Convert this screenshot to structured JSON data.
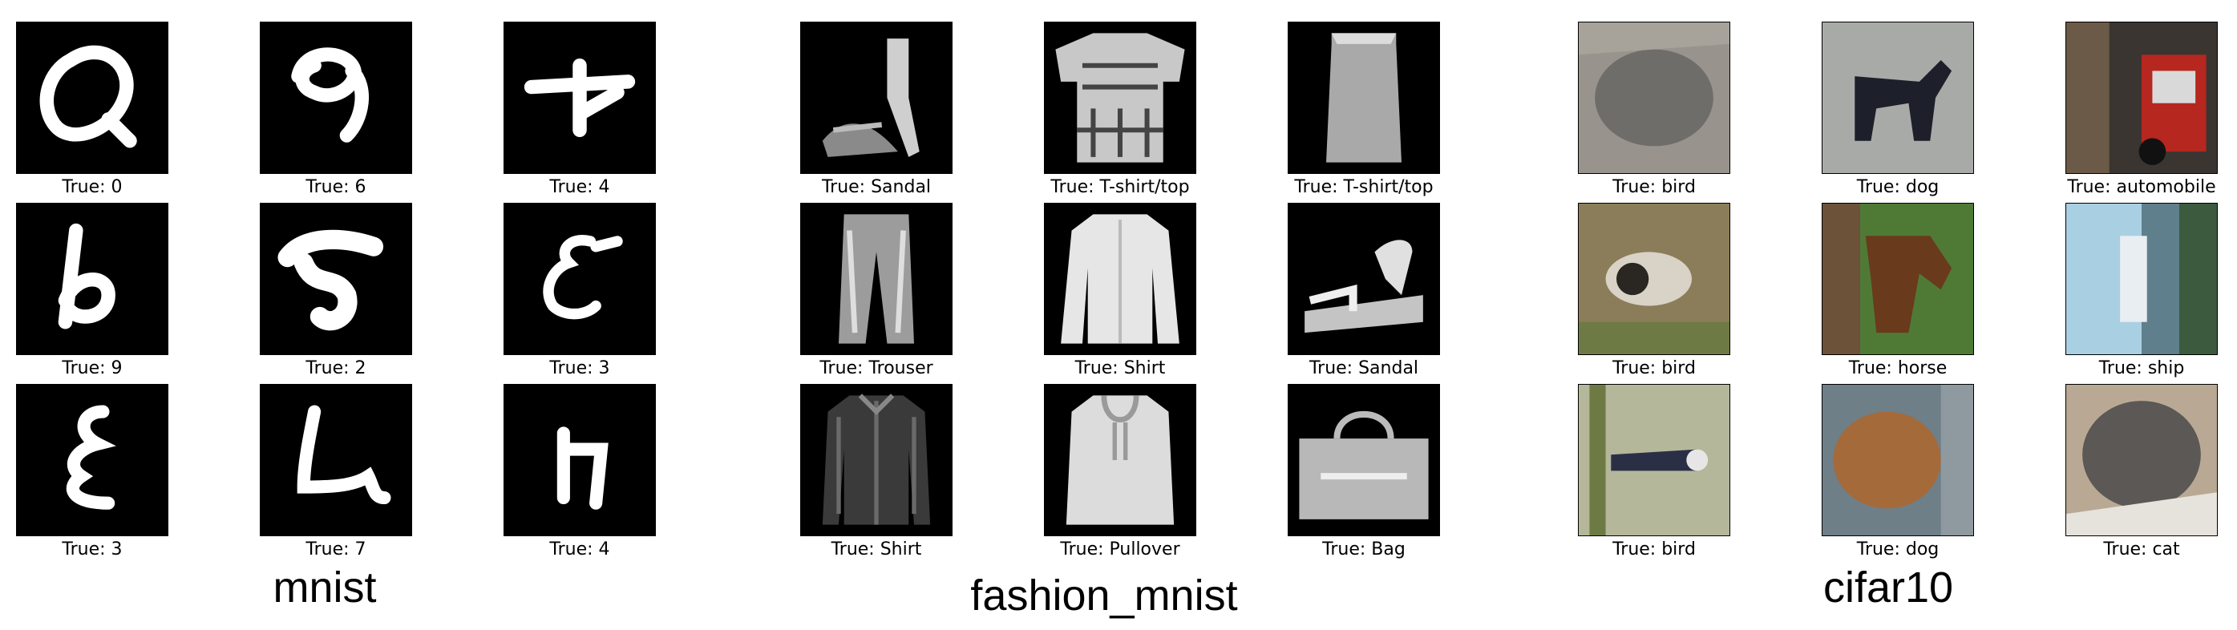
{
  "groups": [
    {
      "title": "mnist",
      "cells": [
        {
          "label": "True: 0",
          "icon": "digit-icon"
        },
        {
          "label": "True: 6",
          "icon": "digit-icon"
        },
        {
          "label": "True: 4",
          "icon": "digit-icon"
        },
        {
          "label": "True: 9",
          "icon": "digit-icon"
        },
        {
          "label": "True: 2",
          "icon": "digit-icon"
        },
        {
          "label": "True: 3",
          "icon": "digit-icon"
        },
        {
          "label": "True: 3",
          "icon": "digit-icon"
        },
        {
          "label": "True: 7",
          "icon": "digit-icon"
        },
        {
          "label": "True: 4",
          "icon": "digit-icon"
        }
      ]
    },
    {
      "title": "fashion_mnist",
      "cells": [
        {
          "label": "True: Sandal",
          "icon": "sandal-icon"
        },
        {
          "label": "True: T-shirt/top",
          "icon": "tshirt-icon"
        },
        {
          "label": "True: T-shirt/top",
          "icon": "tshirt-icon"
        },
        {
          "label": "True: Trouser",
          "icon": "trouser-icon"
        },
        {
          "label": "True: Shirt",
          "icon": "shirt-icon"
        },
        {
          "label": "True: Sandal",
          "icon": "sandal-icon"
        },
        {
          "label": "True: Shirt",
          "icon": "shirt-icon"
        },
        {
          "label": "True: Pullover",
          "icon": "pullover-icon"
        },
        {
          "label": "True: Bag",
          "icon": "bag-icon"
        }
      ]
    },
    {
      "title": "cifar10",
      "cells": [
        {
          "label": "True: bird",
          "icon": "bird-icon"
        },
        {
          "label": "True: dog",
          "icon": "dog-icon"
        },
        {
          "label": "True: automobile",
          "icon": "automobile-icon"
        },
        {
          "label": "True: bird",
          "icon": "bird-icon"
        },
        {
          "label": "True: horse",
          "icon": "horse-icon"
        },
        {
          "label": "True: ship",
          "icon": "ship-icon"
        },
        {
          "label": "True: bird",
          "icon": "bird-icon"
        },
        {
          "label": "True: dog",
          "icon": "dog-icon"
        },
        {
          "label": "True: cat",
          "icon": "cat-icon"
        }
      ]
    }
  ]
}
